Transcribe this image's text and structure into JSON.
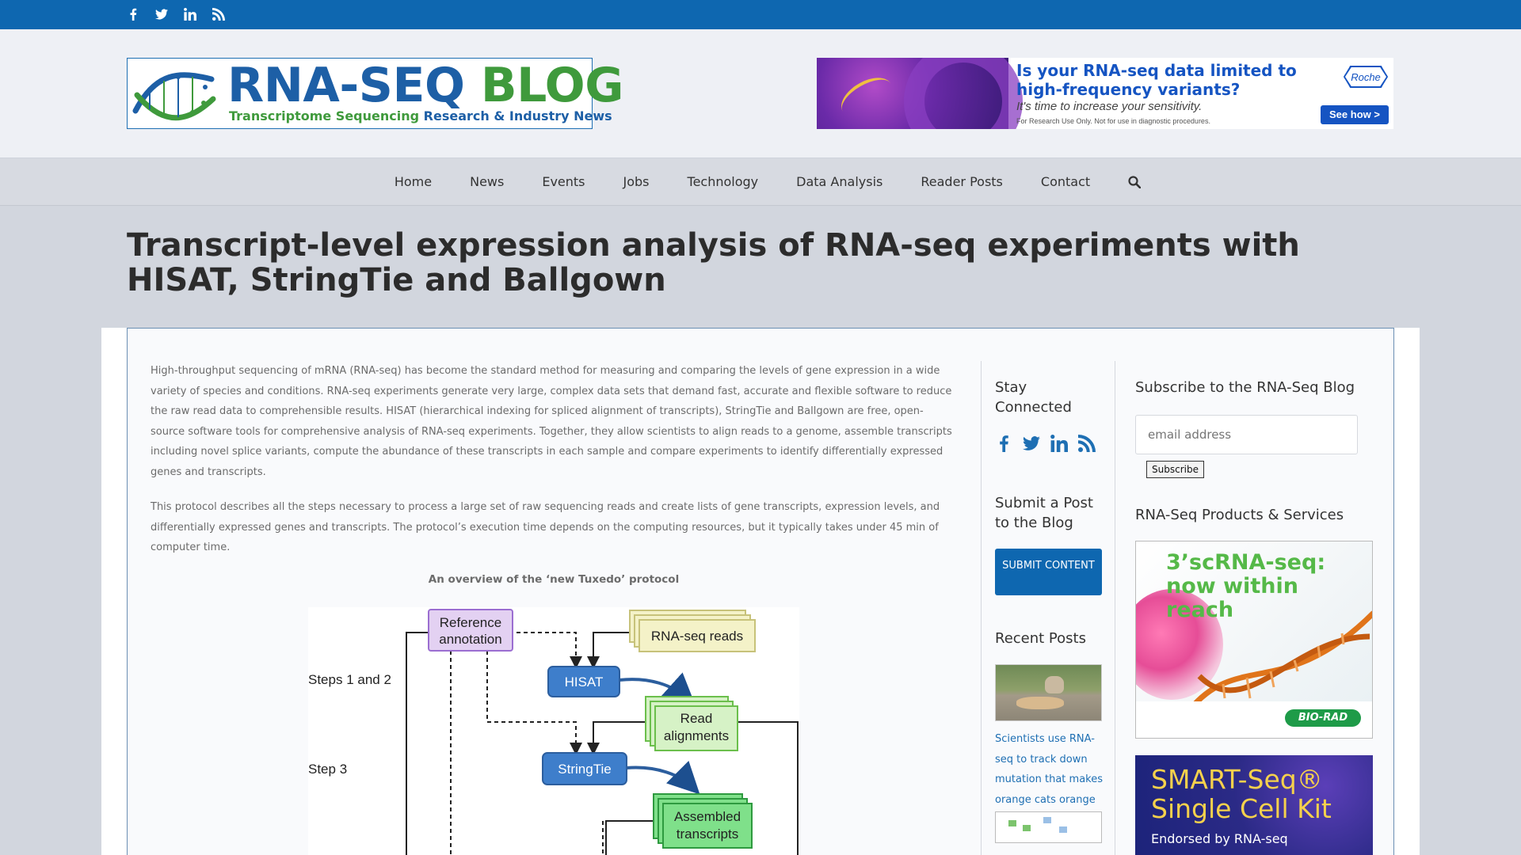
{
  "topbar": {
    "social": [
      "facebook-icon",
      "twitter-icon",
      "linkedin-icon",
      "rss-icon"
    ]
  },
  "logo": {
    "title_part1": "RNA-SEQ",
    "title_part2": "BLOG",
    "tagline_part1": "Transcriptome Sequencing",
    "tagline_part2": "Research & Industry News"
  },
  "top_ad": {
    "headline_line1": "Is your RNA-seq data limited to",
    "headline_line2": "high-frequency variants?",
    "subline": "It's time to increase your sensitivity.",
    "fine_print": "For Research Use Only. Not for use in diagnostic procedures.",
    "brand": "Roche",
    "cta": "See how >"
  },
  "nav": {
    "items": [
      "Home",
      "News",
      "Events",
      "Jobs",
      "Technology",
      "Data Analysis",
      "Reader Posts",
      "Contact"
    ]
  },
  "article": {
    "title": "Transcript-level expression analysis of RNA-seq experiments with HISAT, StringTie and Ballgown",
    "paragraph1": "High-throughput sequencing of mRNA (RNA-seq) has become the standard method for measuring and comparing the levels of gene expression in a wide variety of species and conditions. RNA-seq experiments generate very large, complex data sets that demand fast, accurate and flexible software to reduce the raw read data to comprehensible results. HISAT (hierarchical indexing for spliced alignment of transcripts), StringTie and Ballgown are free, open-source software tools for comprehensive analysis of RNA-seq experiments. Together, they allow scientists to align reads to a genome, assemble transcripts including novel splice variants, compute the abundance of these transcripts in each sample and compare experiments to identify differentially expressed genes and transcripts.",
    "paragraph2": "This protocol describes all the steps necessary to process a large set of raw sequencing reads and create lists of gene transcripts, expression levels, and differentially expressed genes and transcripts. The protocol’s execution time depends on the computing resources, but it typically takes under 45 min of computer time.",
    "figure_caption": "An overview of the ‘new Tuxedo’ protocol",
    "diagram": {
      "reference_line1": "Reference",
      "reference_line2": "annotation",
      "rnaseq_reads": "RNA-seq reads",
      "steps12": "Steps 1 and 2",
      "hisat": "HISAT",
      "read_line1": "Read",
      "read_line2": "alignments",
      "step3": "Step 3",
      "stringtie": "StringTie",
      "assembled_line1": "Assembled",
      "assembled_line2": "transcripts"
    }
  },
  "sidebar1": {
    "stay_connected": "Stay Connected",
    "submit_heading": "Submit a Post to the Blog",
    "submit_button": "SUBMIT CONTENT",
    "recent_posts": "Recent Posts",
    "post1_title": "Scientists use RNA-seq to track down mutation that makes orange cats orange"
  },
  "sidebar2": {
    "subscribe_heading": "Subscribe to the RNA-Seq Blog",
    "email_placeholder": "email address",
    "subscribe_button": "Subscribe",
    "products_heading": "RNA-Seq Products & Services",
    "ad1_line1": "3’scRNA-seq:",
    "ad1_line2": "now within reach",
    "ad1_brand": "BIO-RAD",
    "ad2_line1": "SMART-Seq®",
    "ad2_line2": "Single Cell Kit",
    "ad2_line3": "Endorsed by RNA-seq"
  },
  "colors": {
    "topbar": "#0e67b0",
    "link": "#1e6fb3",
    "logo_blue": "#1d5fa6",
    "logo_green": "#3f9a3c"
  }
}
